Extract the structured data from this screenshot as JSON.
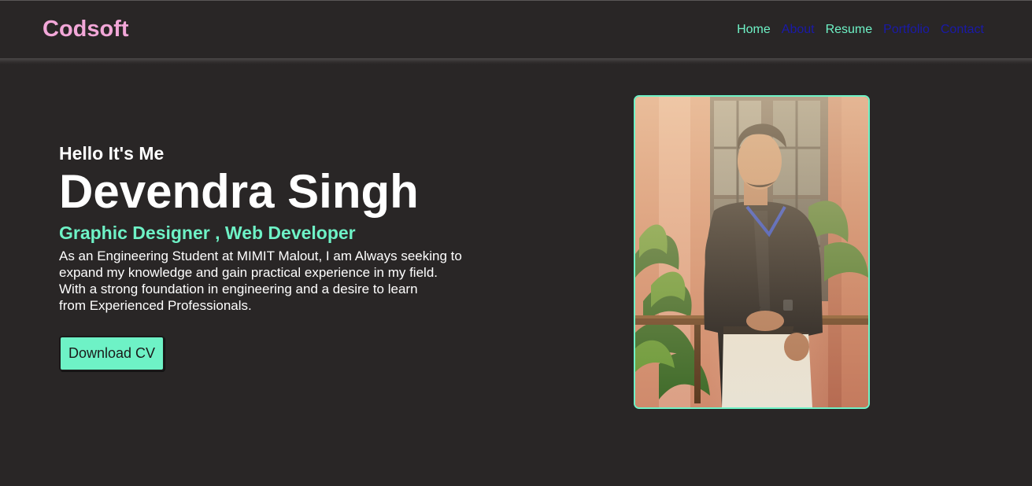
{
  "header": {
    "logo": "Codsoft",
    "nav": [
      {
        "label": "Home",
        "color": "#6ef2c6"
      },
      {
        "label": "About",
        "color": "#1a1aa8"
      },
      {
        "label": "Resume",
        "color": "#6ef2c6"
      },
      {
        "label": "Portfolio",
        "color": "#1a1aa8"
      },
      {
        "label": "Contact",
        "color": "#1a1aa8"
      }
    ]
  },
  "hero": {
    "greeting": "Hello It's Me",
    "name": "Devendra Singh",
    "role": "Graphic Designer , Web Developer",
    "bio_lines": [
      "As an Engineering Student at MIMIT Malout, I am Always seeking to",
      "expand my knowledge and gain practical experience in my field.",
      "With a strong foundation in engineering and a desire to learn",
      "from Experienced Professionals."
    ],
    "cv_button": "Download CV"
  },
  "colors": {
    "background": "#292626",
    "accent": "#6ef2c6",
    "logo": "#f2a7d8",
    "nav_link_visited": "#1a1aa8"
  }
}
